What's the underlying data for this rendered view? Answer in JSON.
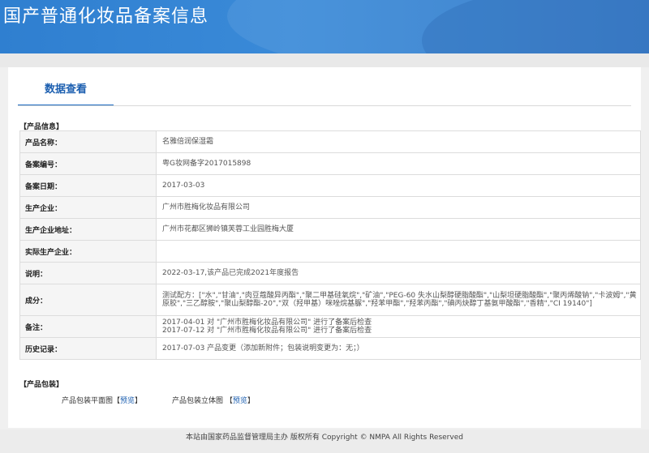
{
  "header": {
    "title": "国产普通化妆品备案信息"
  },
  "tab": {
    "label": "数据查看"
  },
  "product_info": {
    "section_label": "【产品信息】",
    "rows": [
      {
        "label": "产品名称：",
        "value": "名雅倍润保湿霜"
      },
      {
        "label": "备案编号：",
        "value": "粤G妆网备字2017015898"
      },
      {
        "label": "备案日期：",
        "value": "2017-03-03"
      },
      {
        "label": "生产企业：",
        "value": "广州市胜梅化妆品有限公司"
      },
      {
        "label": "生产企业地址：",
        "value": "广州市花都区狮岭镇芙蓉工业园胜梅大厦"
      },
      {
        "label": "实际生产企业：",
        "value": ""
      },
      {
        "label": "说明：",
        "value": "2022-03-17,该产品已完成2021年度报告"
      },
      {
        "label": "成分：",
        "value": "测试配方：[\"水\",\"甘油\",\"肉豆蔻酸异丙酯\",\"聚二甲基硅氧烷\",\"矿油\",\"PEG-60 失水山梨醇硬脂酸酯\",\"山梨坦硬脂酸酯\",\"聚丙烯酸钠\",\"卡波姆\",\"黄原胶\",\"三乙醇胺\",\"聚山梨醇酯-20\",\"双（羟甲基）咪唑烷基脲\",\"羟苯甲酯\",\"羟苯丙酯\",\"碘丙炔醇丁基氨甲酸酯\",\"香精\",\"CI 19140\"]"
      },
      {
        "label": "备注：",
        "value_lines": [
          "2017-04-01 对 \"广州市胜梅化妆品有限公司\" 进行了备案后检查",
          "2017-07-12 对 \"广州市胜梅化妆品有限公司\" 进行了备案后检查"
        ]
      },
      {
        "label": "历史记录：",
        "value": "2017-07-03 产品变更（添加新附件；包装说明变更为：无；）"
      }
    ]
  },
  "packaging": {
    "section_label": "【产品包装】",
    "plan_label": "产品包装平面图",
    "plan_link": "预览",
    "solid_label": "产品包装立体图",
    "solid_link": "预览",
    "bracket_open": "【",
    "bracket_close": "】"
  },
  "footer": {
    "text": "本站由国家药品监督管理局主办 版权所有 Copyright © NMPA All Rights Reserved"
  }
}
